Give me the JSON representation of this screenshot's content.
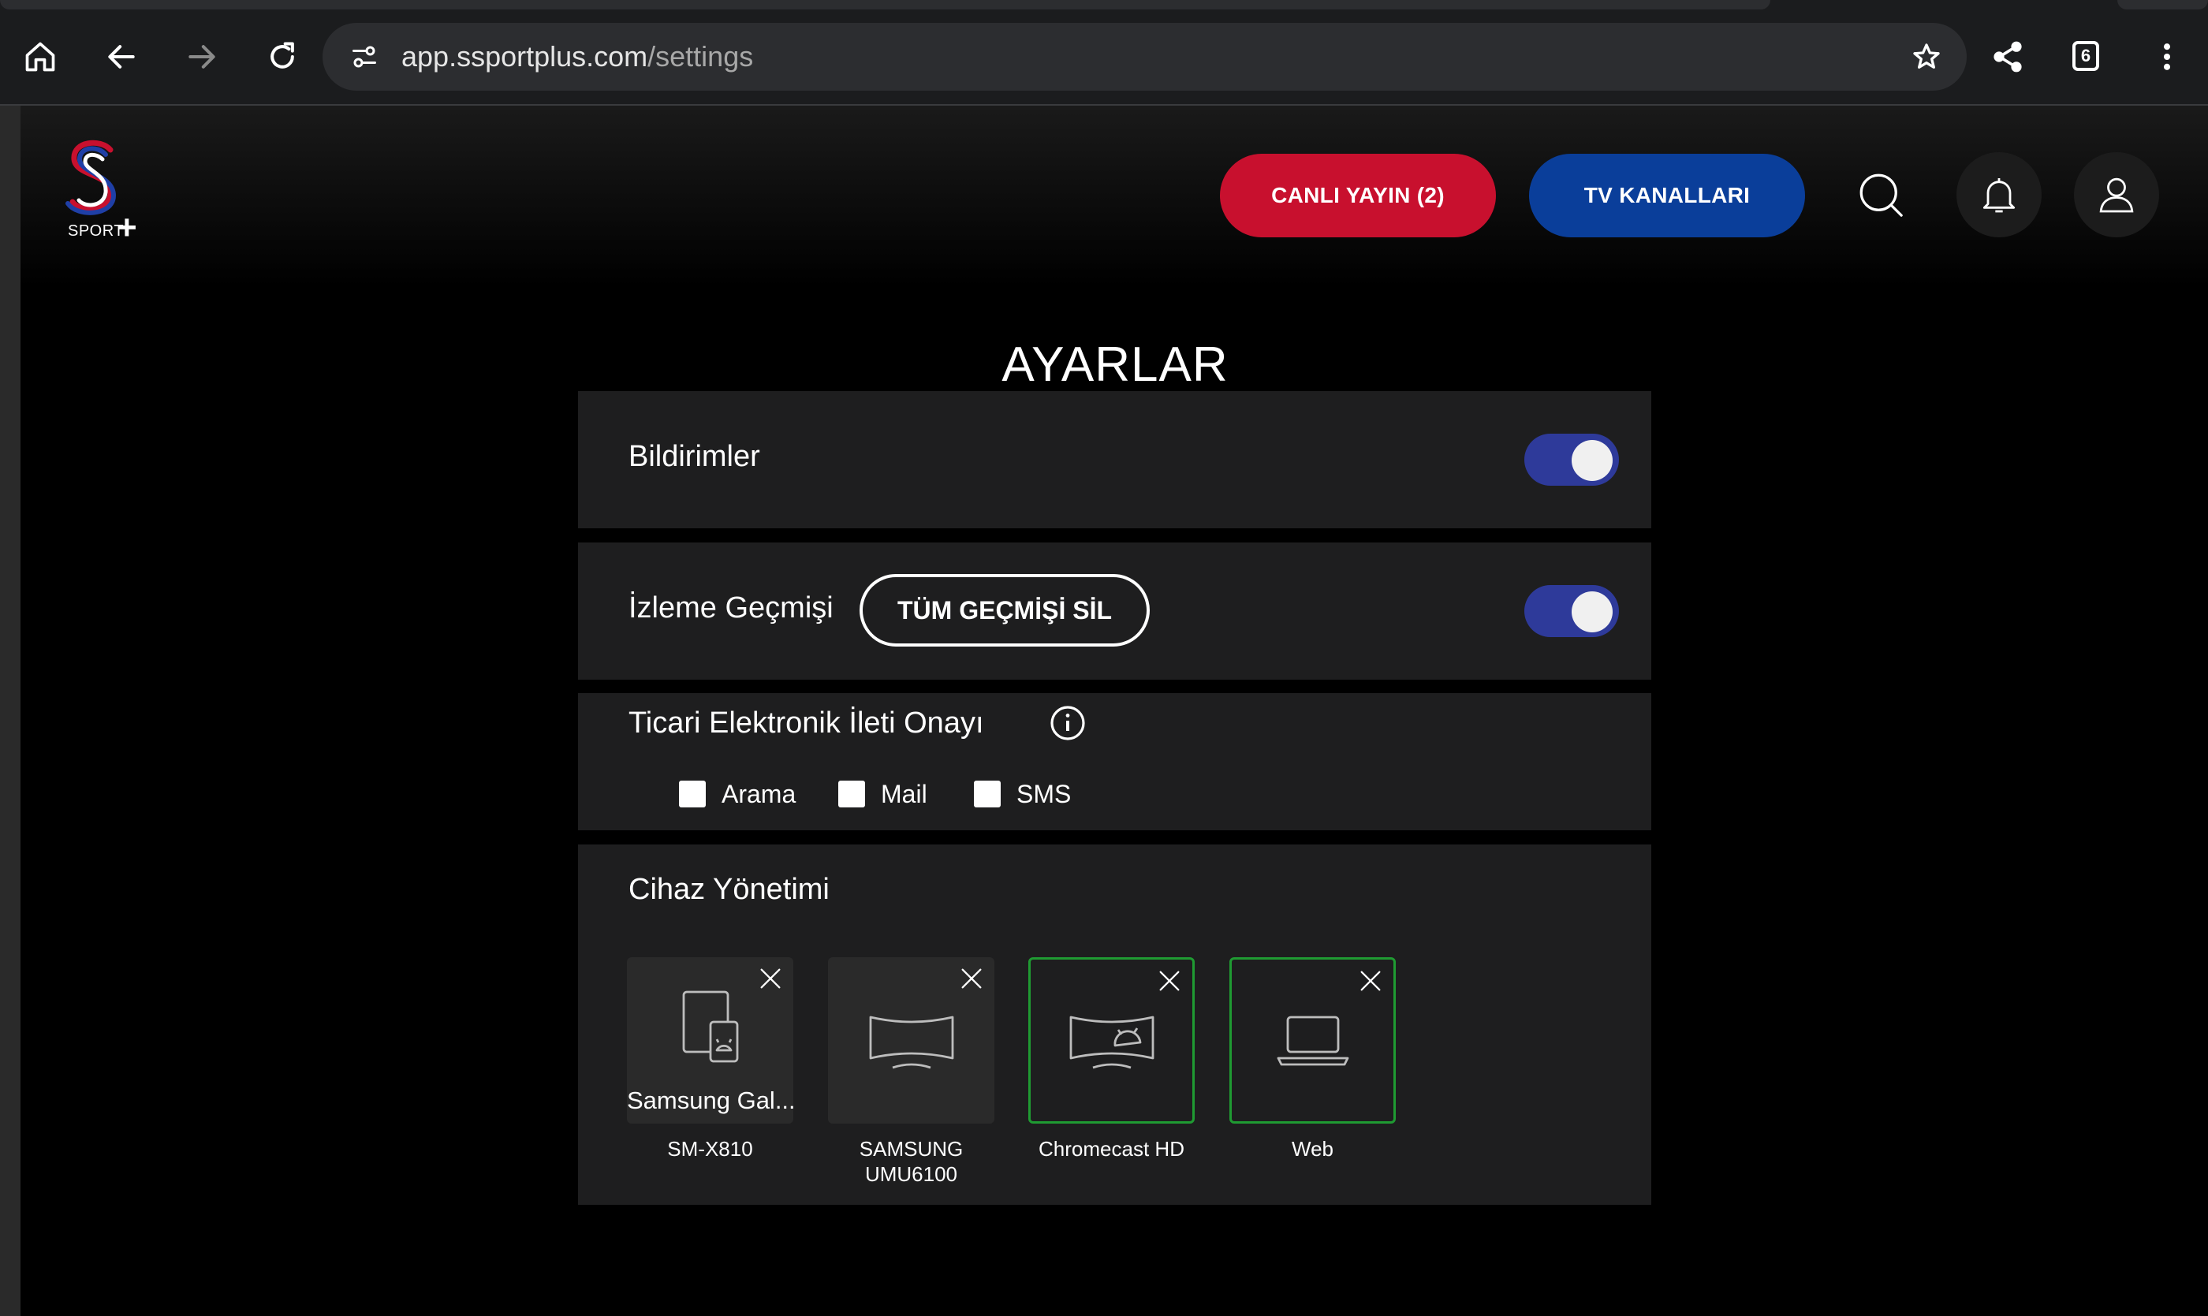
{
  "browser": {
    "url_host": "app.ssportplus.com",
    "url_path": "/settings",
    "tab_count": "6"
  },
  "header": {
    "logo_text": "SPORT",
    "logo_plus": "+",
    "live_button": "CANLI YAYIN (2)",
    "tv_button": "TV KANALLARI"
  },
  "page": {
    "title": "AYARLAR"
  },
  "settings": {
    "notifications": {
      "label": "Bildirimler",
      "enabled": true
    },
    "history": {
      "label": "İzleme Geçmişi",
      "clear_button": "TÜM GEÇMİŞİ SİL",
      "enabled": true
    },
    "consent": {
      "label": "Ticari Elektronik İleti Onayı",
      "options": [
        {
          "label": "Arama",
          "checked": false
        },
        {
          "label": "Mail",
          "checked": false
        },
        {
          "label": "SMS",
          "checked": false
        }
      ]
    },
    "devices": {
      "label": "Cihaz Yönetimi",
      "items": [
        {
          "name": "Samsung Gal...",
          "caption": "SM-X810",
          "icon": "tablet-android-icon",
          "active": false
        },
        {
          "name": "",
          "caption": "SAMSUNG UMU6100",
          "icon": "tv-icon",
          "active": false
        },
        {
          "name": "",
          "caption": "Chromecast HD",
          "icon": "tv-android-icon",
          "active": true
        },
        {
          "name": "",
          "caption": "Web",
          "icon": "laptop-icon",
          "active": true
        }
      ]
    }
  },
  "colors": {
    "live_red": "#c8102e",
    "tv_blue": "#0a3e9a",
    "toggle_on": "#2e3a9a",
    "active_device_border": "#1f9b32"
  }
}
